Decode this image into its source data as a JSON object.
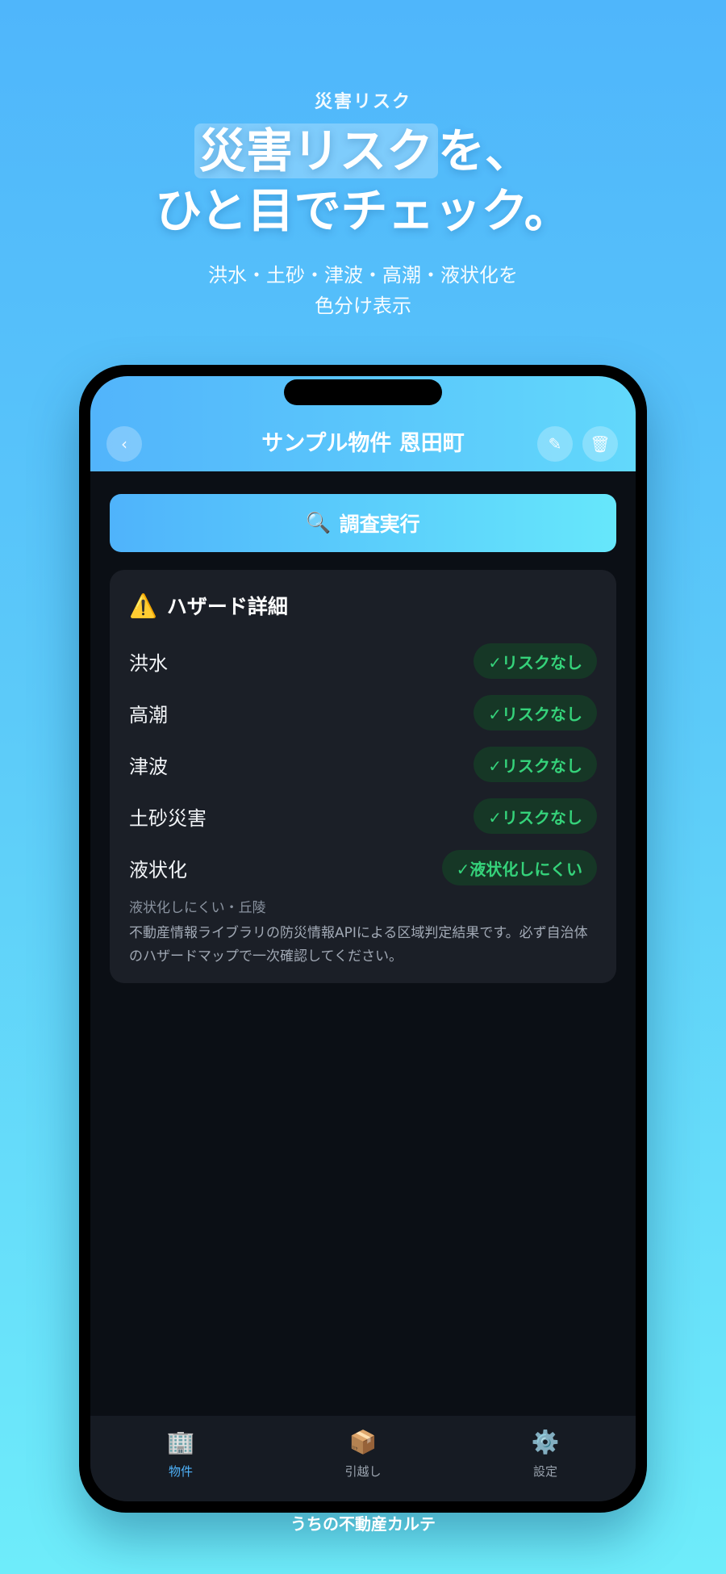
{
  "promo": {
    "eyebrow": "災害リスク",
    "headline_highlight": "災害リスク",
    "headline_rest1": "を、",
    "headline_line2": "ひと目でチェック。",
    "subtitle_line1": "洪水・土砂・津波・高潮・液状化を",
    "subtitle_line2": "色分け表示"
  },
  "header": {
    "title": "サンプル物件 恩田町",
    "back_icon": "‹",
    "edit_icon": "✎",
    "trash_icon": "🗑"
  },
  "run_button": {
    "icon": "🔍",
    "label": "調査実行"
  },
  "hazard": {
    "icon": "⚠️",
    "title": "ハザード詳細",
    "items": [
      {
        "label": "洪水",
        "status": "✓リスクなし"
      },
      {
        "label": "高潮",
        "status": "✓リスクなし"
      },
      {
        "label": "津波",
        "status": "✓リスクなし"
      },
      {
        "label": "土砂災害",
        "status": "✓リスクなし"
      },
      {
        "label": "液状化",
        "status": "✓液状化しにくい"
      }
    ],
    "note_terrain": "液状化しにくい・丘陵",
    "note_source": "不動産情報ライブラリの防災情報APIによる区域判定結果です。必ず自治体のハザードマップで一次確認してください。"
  },
  "tabs": [
    {
      "icon": "🏢",
      "label": "物件",
      "active": true
    },
    {
      "icon": "📦",
      "label": "引越し",
      "active": false
    },
    {
      "icon": "⚙️",
      "label": "設定",
      "active": false
    }
  ],
  "footer": "うちの不動産カルテ",
  "colors": {
    "accent": "#4fb3fb",
    "safe_text": "#35d27a",
    "safe_bg": "#163726",
    "card_bg": "#1b1f27",
    "screen_bg": "#0b0f15"
  }
}
